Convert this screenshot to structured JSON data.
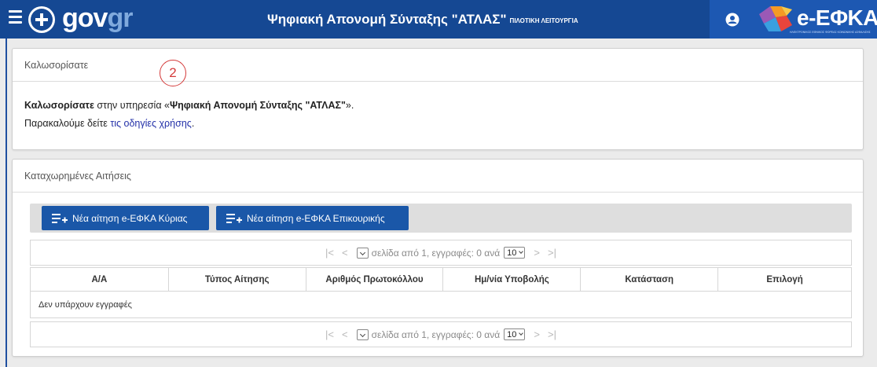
{
  "header": {
    "logo_gov": "gov",
    "logo_gr": "gr",
    "title": "Ψηφιακή Απονομή Σύνταξης \"ΑΤΛΑΣ\"",
    "pilot_label": "ΠΙΛΟΤΙΚΗ ΛΕΙΤΟΥΡΓΙΑ",
    "brand_name": "e-ΕΦΚΑ",
    "brand_subtitle": "ΗΛΕΚΤΡΟΝΙΚΟΣ ΕΘΝΙΚΟΣ ΦΟΡΕΑΣ ΚΟΙΝΩΝΙΚΗΣ ΑΣΦΑΛΙΣΗΣ",
    "colors": {
      "bar": "#154893",
      "brand_panel": "#1d58b2"
    }
  },
  "welcome": {
    "heading": "Καλωσορίσατε",
    "step_number": "2",
    "line1_bold": "Καλωσορίσατε",
    "line1_text": " στην υπηρεσία «",
    "line1_service": "Ψηφιακή Απονομή Σύνταξης \"ΑΤΛΑΣ\"",
    "line1_end": "».",
    "line2_text": "Παρακαλούμε δείτε ",
    "line2_link": "τις οδηγίες χρήσης",
    "line2_end": "."
  },
  "applications": {
    "heading": "Καταχωρημένες Αιτήσεις",
    "buttons": {
      "new_main": "Νέα αίτηση e-ΕΦΚΑ Κύριας",
      "new_supplementary": "Νέα αίτηση e-ΕΦΚΑ Επικουρικής"
    },
    "pager": {
      "first": "|<",
      "prev": "<",
      "next": ">",
      "last": ">|",
      "text": "σελίδα από 1, εγγραφές: 0 ανά",
      "page_size": "10"
    },
    "columns": [
      "Α/Α",
      "Τύπος Αίτησης",
      "Αριθμός Πρωτοκόλλου",
      "Ημ/νία Υποβολής",
      "Κατάσταση",
      "Επιλογή"
    ],
    "empty_text": "Δεν υπάρχουν εγγραφές"
  }
}
